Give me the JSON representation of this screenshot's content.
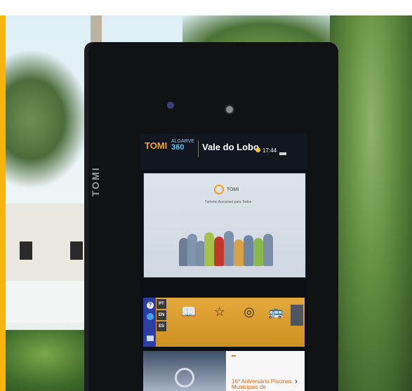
{
  "kiosk": {
    "brand_vertical": "TOMI"
  },
  "screen": {
    "logo_tomi": "TOMI",
    "logo_algarve_small": "ALGARVE",
    "logo_algarve_big": "360",
    "title": "Vale do Lobo",
    "time": "17:44",
    "video": {
      "logo_text": "TOMI",
      "caption": "Turismo Acessível para Todos"
    },
    "sidebar": {
      "help": "?",
      "languages": [
        "PT",
        "EN",
        "ES"
      ]
    },
    "tiles": [
      {
        "icon": "book-icon",
        "glyph": "📖"
      },
      {
        "icon": "star-icon",
        "glyph": "☆"
      },
      {
        "icon": "food-icon",
        "glyph": "◎"
      },
      {
        "icon": "bus-icon",
        "glyph": "🚌"
      }
    ],
    "news": {
      "title": "16º Aniversário Piscinas Municipais de"
    }
  },
  "colors": {
    "accent_bar": "#f6b40e",
    "tiles_orange": "#e3a93b",
    "sidebar_blue": "#2d3ea3",
    "news_title": "#d36b12"
  }
}
